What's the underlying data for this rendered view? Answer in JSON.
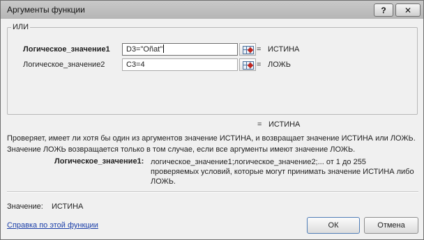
{
  "window": {
    "title": "Аргументы функции",
    "help_glyph": "?",
    "close_glyph": "✕"
  },
  "function": {
    "name": "ИЛИ",
    "args": [
      {
        "label": "Логическое_значение1",
        "value": "D3=\"Oñat\"",
        "result": "ИСТИНА"
      },
      {
        "label": "Логическое_значение2",
        "value": "C3=4",
        "result": "ЛОЖЬ"
      }
    ],
    "equals": "=",
    "overall_result": "ИСТИНА"
  },
  "description": "Проверяет, имеет ли хотя бы один из аргументов значение ИСТИНА, и возвращает значение ИСТИНА или ЛОЖЬ. Значение ЛОЖЬ возвращается только в том случае, если все аргументы имеют значение ЛОЖЬ.",
  "arg_help": {
    "label": "Логическое_значение1:",
    "text": "логическое_значение1;логическое_значение2;... от 1 до 255 проверяемых условий, которые могут принимать значение ИСТИНА либо ЛОЖЬ."
  },
  "value_label": "Значение:",
  "value": "ИСТИНА",
  "help_link": "Справка по этой функции",
  "buttons": {
    "ok": "ОК",
    "cancel": "Отмена"
  }
}
